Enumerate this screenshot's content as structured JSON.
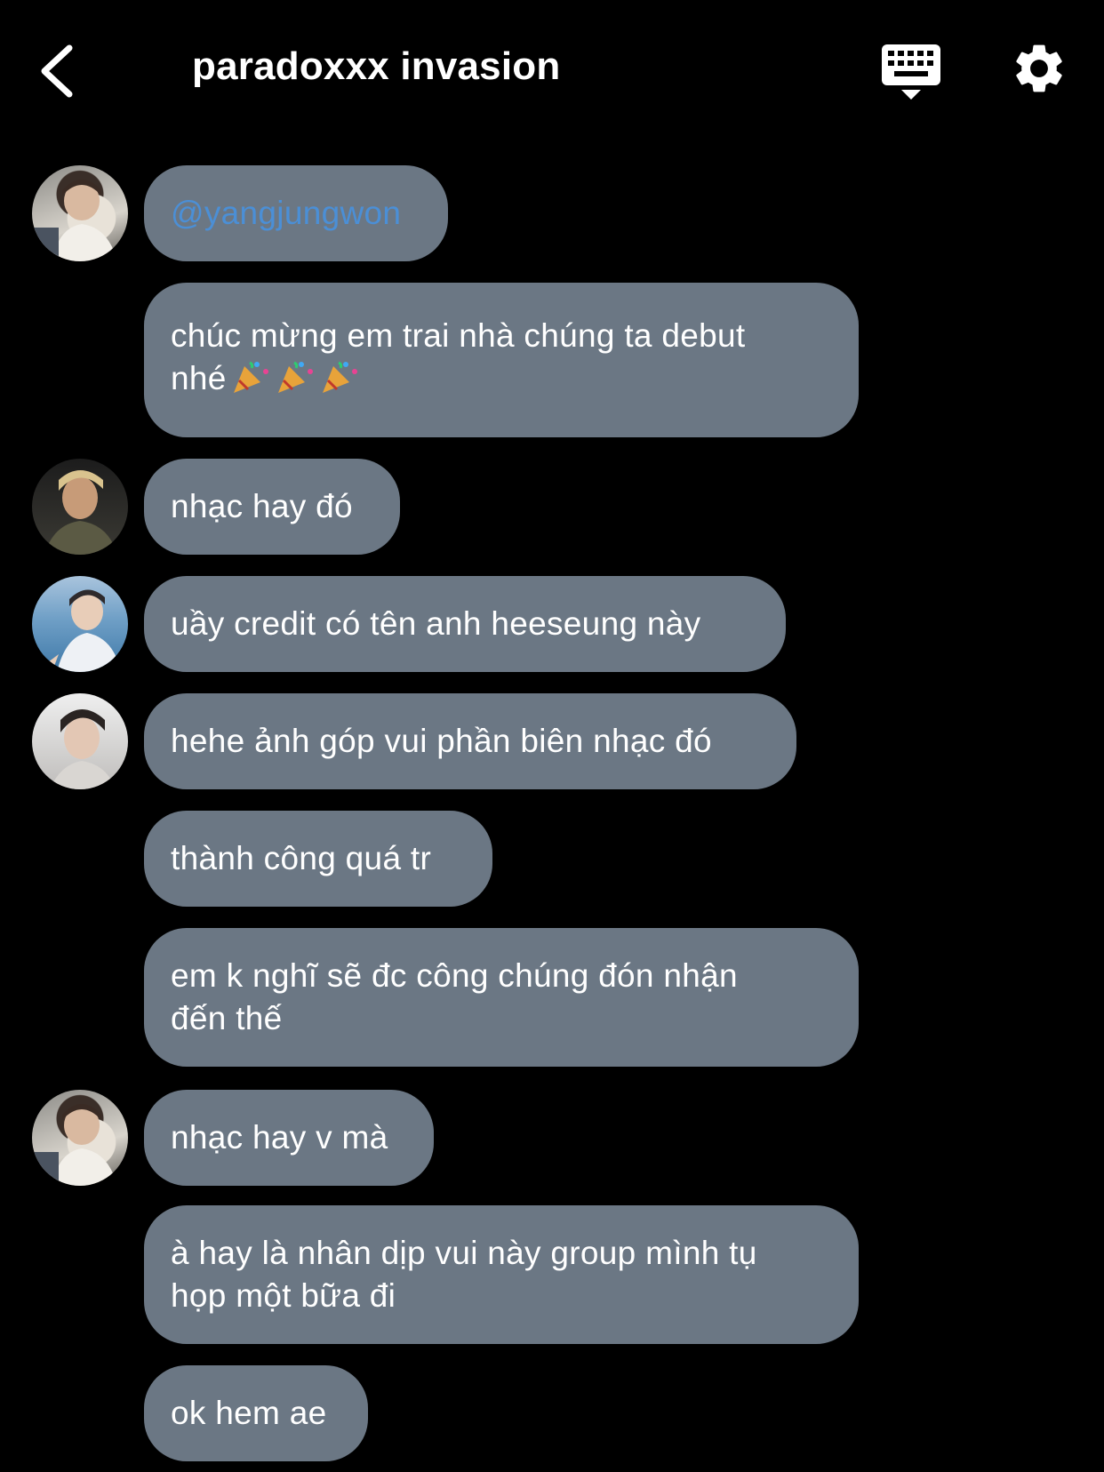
{
  "header": {
    "title": "paradoxxx invasion",
    "back_icon": "chevron-left-icon",
    "keyboard_icon": "keyboard-icon",
    "settings_icon": "gear-icon"
  },
  "colors": {
    "background": "#000000",
    "bubble": "#6b7784",
    "mention": "#4b8fd6",
    "text": "#ffffff"
  },
  "messages": [
    {
      "text": "@yangjungwon",
      "mention": true
    },
    {
      "text": "chúc mừng em trai nhà chúng ta debut\nnhé",
      "emoji": "party-popper-icon ×3"
    },
    {
      "text": "nhạc hay đó"
    },
    {
      "text": "uầy credit có tên anh heeseung này"
    },
    {
      "text": "hehe ảnh góp vui phần biên nhạc đó"
    },
    {
      "text": "thành công quá tr"
    },
    {
      "text": "em k nghĩ sẽ đc công chúng đón nhận\nđến thế"
    },
    {
      "text": "nhạc hay v mà"
    },
    {
      "text": "à hay là nhân dịp vui này group mình tụ\nhọp một bữa đi"
    },
    {
      "text": "ok hem ae"
    }
  ]
}
